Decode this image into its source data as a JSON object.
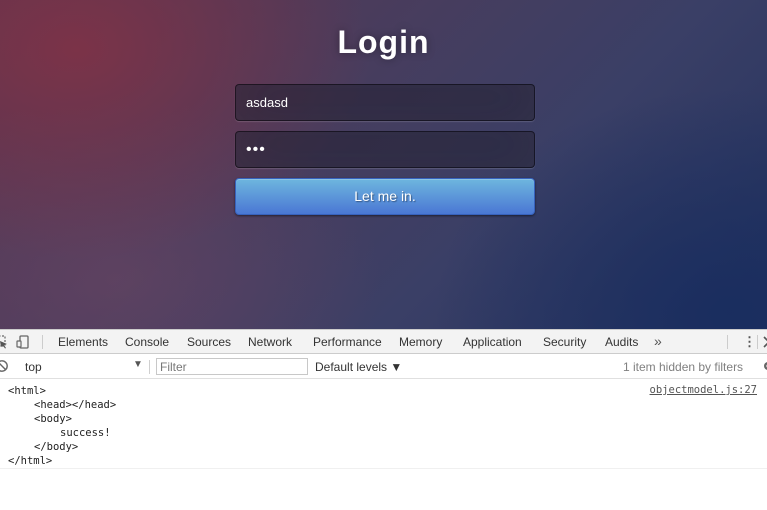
{
  "login": {
    "title": "Login",
    "username_value": "asdasd",
    "password_mask": "•••",
    "submit_label": "Let me in."
  },
  "devtools": {
    "tabs": [
      "Elements",
      "Console",
      "Sources",
      "Network",
      "Performance",
      "Memory",
      "Application",
      "Security",
      "Audits"
    ],
    "active_tab": "Console",
    "more_tabs": "»",
    "menu": "⋮",
    "toolbar": {
      "context": "top",
      "context_arrow": "▼",
      "filter_placeholder": "Filter",
      "levels": "Default levels ▼",
      "hidden_note": "1 item hidden by filters"
    },
    "console": {
      "source_link": "objectmodel.js:27",
      "lines": [
        "<html>",
        "<head></head>",
        "<body>",
        "success!",
        "</body>",
        "</html>"
      ]
    }
  },
  "colors": {
    "button_top": "#6eb6de",
    "button_bottom": "#4a77d4",
    "devtools_bar": "#f3f3f3"
  },
  "icons": [
    "inspect-element-icon",
    "device-toolbar-icon",
    "clear-console-icon",
    "more-tabs-icon",
    "kebab-menu-icon"
  ]
}
